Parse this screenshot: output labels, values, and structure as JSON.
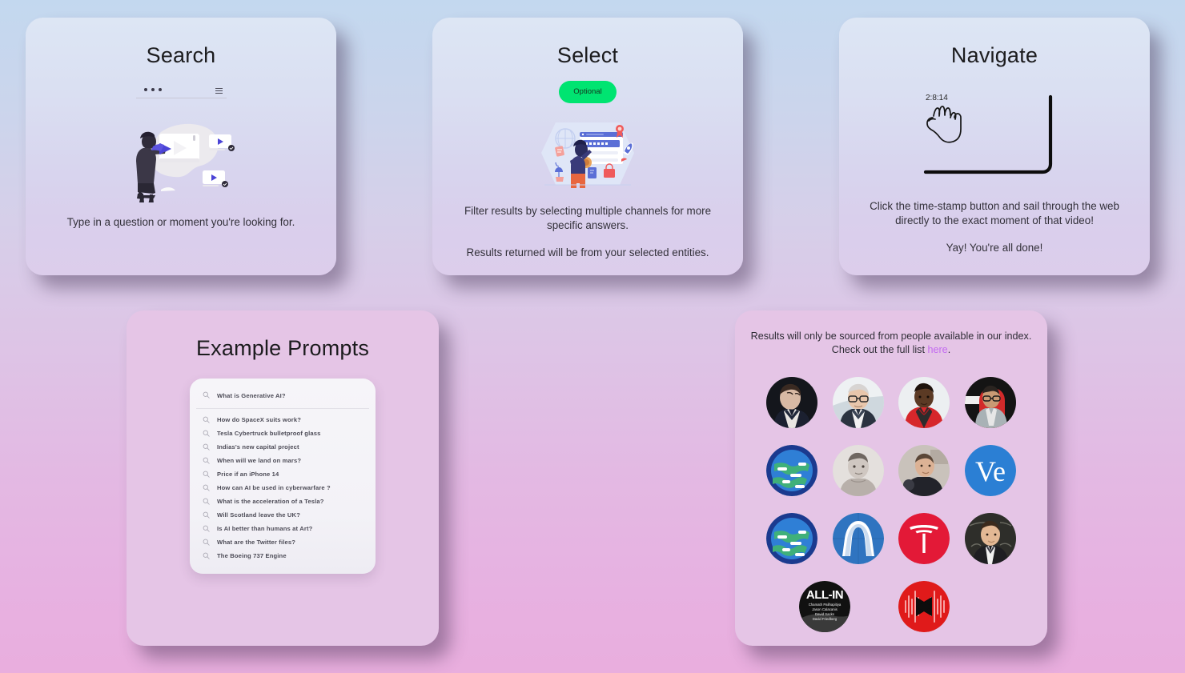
{
  "background": {
    "top_color": "#c3d8ef",
    "bottom_color": "#e9aede"
  },
  "cards": {
    "search": {
      "title": "Search",
      "description": "Type in a question or moment you're looking for.",
      "searchbar_icon_left": "three-dots-icon",
      "searchbar_icon_right": "menu-icon"
    },
    "select": {
      "title": "Select",
      "badge": "Optional",
      "badge_color": "#00e471",
      "description_1": "Filter results by selecting multiple channels for more specific answers.",
      "description_2": "Results returned will be from your selected entities."
    },
    "navigate": {
      "title": "Navigate",
      "timestamp": "2:8:14",
      "description_1": "Click the time-stamp button and sail through the web directly to the exact moment of that video!",
      "description_2": "Yay! You're all done!"
    },
    "prompts": {
      "title": "Example Prompts",
      "featured": "What is Generative AI?",
      "items": [
        "How do SpaceX suits work?",
        "Tesla Cybertruck bulletproof glass",
        "Indias's new capital project",
        "When will we land on mars?",
        "Price if an iPhone 14",
        "How can AI be used in cyberwarfare ?",
        "What is the acceleration of a Tesla?",
        "Will Scotland leave the UK?",
        "Is AI better than humans  at Art?",
        "What are the Twitter files?",
        "The Boeing 737 Engine"
      ]
    },
    "index": {
      "note_line_1": "Results will only be sourced from people available in our index.",
      "note_line_2_prefix": "Check out the full list ",
      "note_link": "here",
      "note_line_2_suffix": ".",
      "link_color": "#c36bf0",
      "avatars": [
        {
          "name": "elon-musk-avatar",
          "type": "photo"
        },
        {
          "name": "tim-cook-avatar",
          "type": "photo"
        },
        {
          "name": "mkbhd-avatar",
          "type": "photo"
        },
        {
          "name": "sundar-pichai-avatar",
          "type": "photo"
        },
        {
          "name": "kurzgesagt-avatar",
          "type": "logo"
        },
        {
          "name": "sam-altman-avatar",
          "type": "photo"
        },
        {
          "name": "lex-guest-avatar",
          "type": "photo"
        },
        {
          "name": "veritasium-avatar",
          "type": "logo",
          "label": "Ve"
        },
        {
          "name": "kurzgesagt-avatar-2",
          "type": "logo"
        },
        {
          "name": "arch-logo-avatar",
          "type": "logo"
        },
        {
          "name": "tesla-avatar",
          "type": "logo"
        },
        {
          "name": "lecture-speaker-avatar",
          "type": "photo"
        },
        {
          "name": "all-in-podcast-avatar",
          "type": "logo",
          "label": "ALL-IN",
          "hosts": [
            "Chamath Palihapitiya",
            "Jason Calacanis",
            "David Sacks",
            "David Friedberg"
          ]
        },
        {
          "name": "waveform-podcast-avatar",
          "type": "logo"
        }
      ]
    }
  }
}
